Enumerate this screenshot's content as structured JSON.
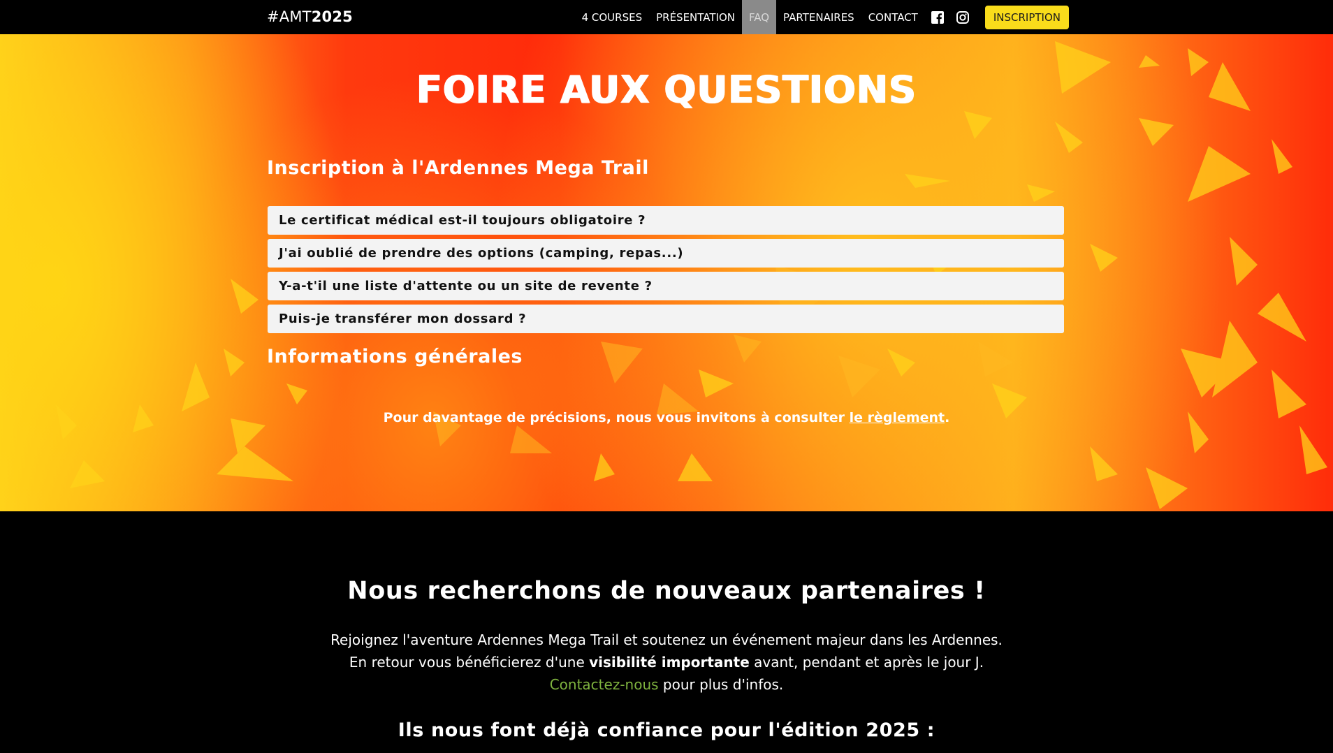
{
  "colors": {
    "navbar_bg": "#000000",
    "active_nav_bg": "#8a8a8a",
    "inscription_button_bg": "#f9dc1b",
    "hero_gradient_warm": "#ff2a0a",
    "hero_gradient_light": "#ffcf1e",
    "faq_item_bg": "#f3f3f3",
    "contact_link": "#7fb33f"
  },
  "nav": {
    "brand_prefix": "#AMT",
    "brand_year": "2025",
    "links": [
      {
        "label": "4 COURSES"
      },
      {
        "label": "PRÉSENTATION"
      },
      {
        "label": "FAQ",
        "active": true
      },
      {
        "label": "PARTENAIRES"
      },
      {
        "label": "CONTACT"
      }
    ],
    "social_icons": [
      "facebook-icon",
      "instagram-icon"
    ],
    "cta_label": "INSCRIPTION"
  },
  "faq": {
    "title": "FOIRE AUX QUESTIONS",
    "sections": [
      {
        "heading": "Inscription à l'Ardennes Mega Trail",
        "questions": [
          "Le certificat médical est-il toujours obligatoire ?",
          "J'ai oublié de prendre des options (camping, repas...)",
          "Y-a-t'il une liste d'attente ou un site de revente ?",
          "Puis-je transférer mon dossard ?"
        ]
      },
      {
        "heading": "Informations générales",
        "questions": []
      }
    ],
    "more_info_text": "Pour davantage de précisions, nous vous invitons à consulter ",
    "more_info_link": "le règlement",
    "more_info_end": "."
  },
  "partners": {
    "title": "Nous recherchons de nouveaux partenaires !",
    "line1": "Rejoignez l'aventure Ardennes Mega Trail et soutenez un événement majeur dans les Ardennes.",
    "line2_start": "En retour vous bénéficierez d'une ",
    "line2_highlight": "visibilité importante",
    "line2_end": " avant, pendant et après le jour J.",
    "contact_link": "Contactez-nous",
    "line3_end": " pour plus d'infos.",
    "subtitle": "Ils nous font déjà confiance pour l'édition 2025 :"
  }
}
